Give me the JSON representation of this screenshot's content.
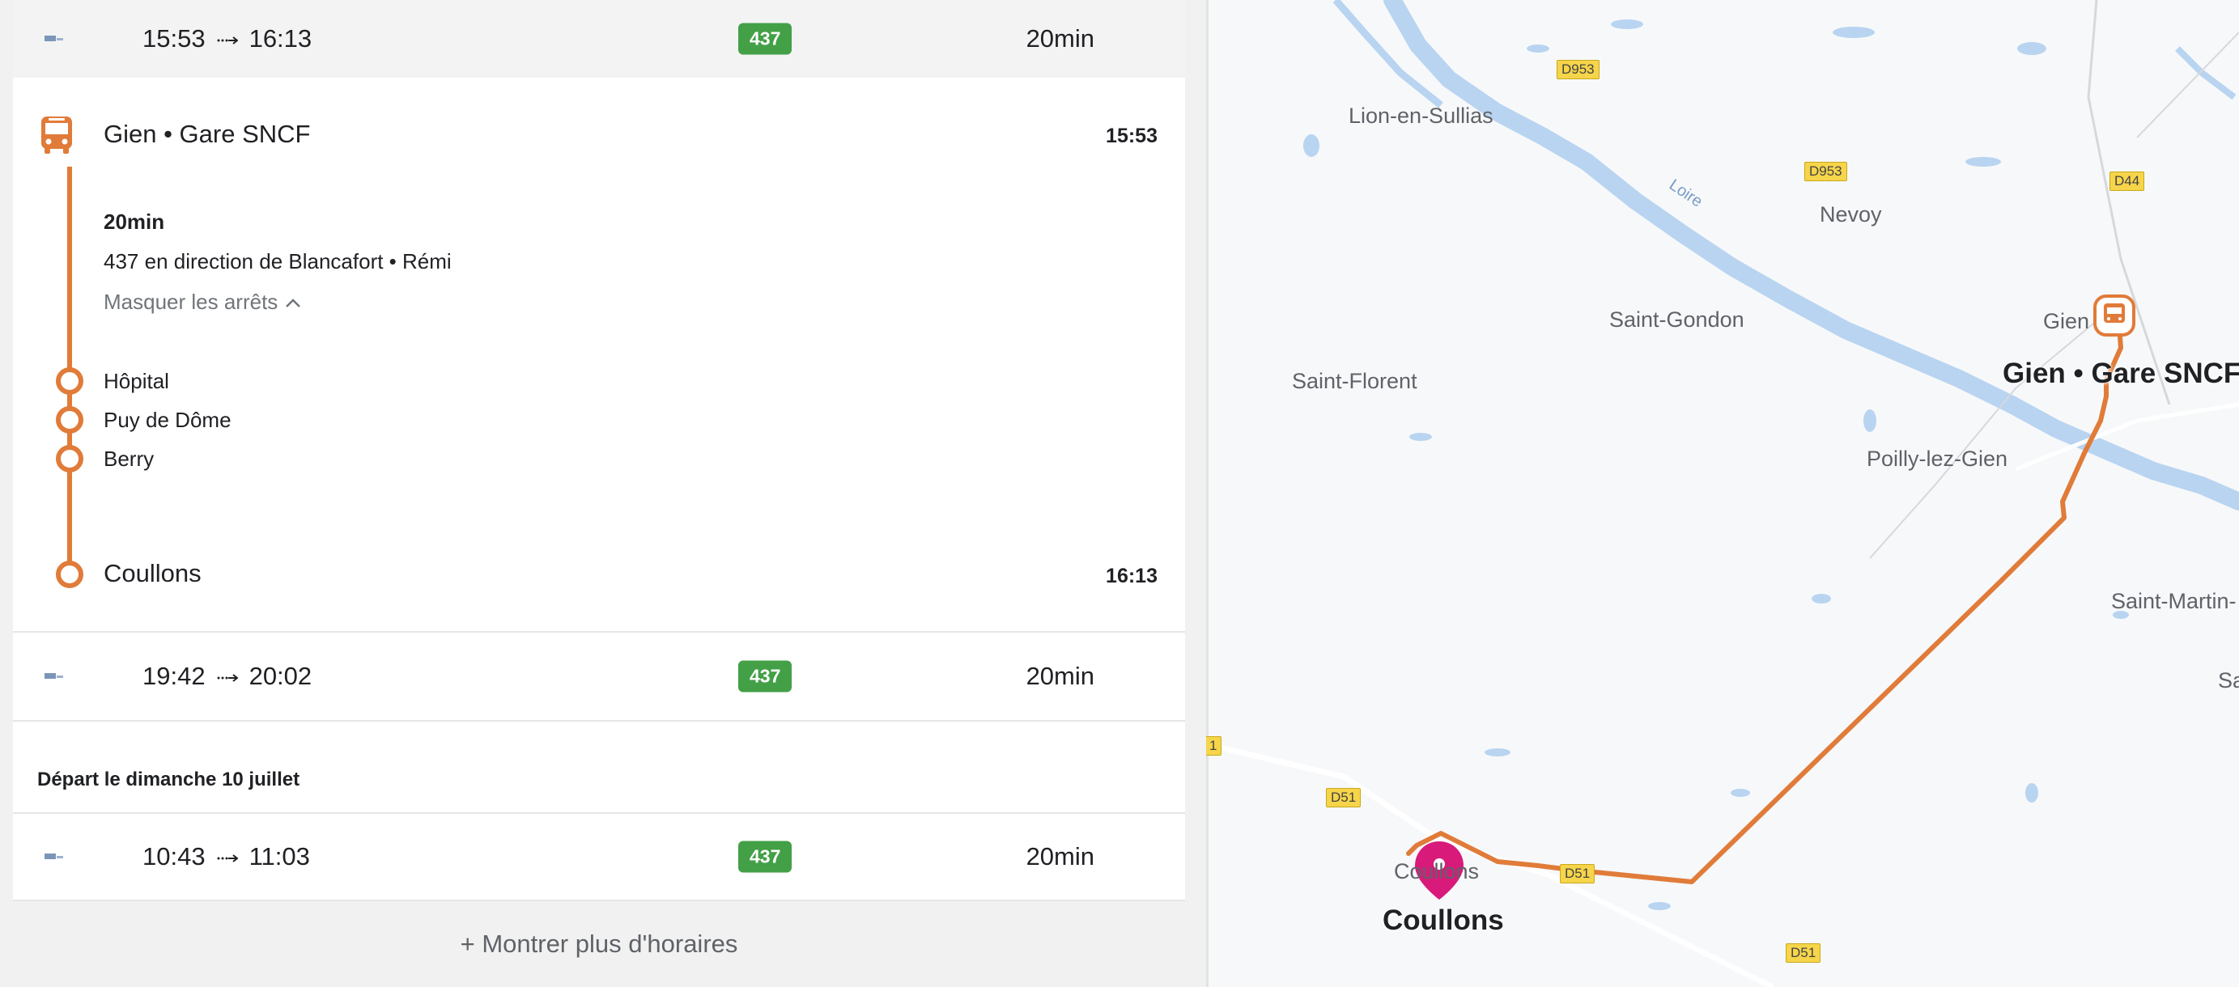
{
  "trips": [
    {
      "depart": "15:53",
      "arrive": "16:13",
      "line": "437",
      "duration": "20min"
    },
    {
      "depart": "19:42",
      "arrive": "20:02",
      "line": "437",
      "duration": "20min"
    },
    {
      "depart": "10:43",
      "arrive": "11:03",
      "line": "437",
      "duration": "20min"
    }
  ],
  "detail": {
    "origin": "Gien • Gare SNCF",
    "origin_time": "15:53",
    "duration": "20min",
    "direction": "437 en direction de Blancafort • Rémi",
    "toggle_label": "Masquer les arrêts",
    "stops": [
      "Hôpital",
      "Puy de Dôme",
      "Berry"
    ],
    "destination": "Coullons",
    "destination_time": "16:13"
  },
  "section_header": "Départ le dimanche 10 juillet",
  "more_button": "+ Montrer plus d'horaires",
  "colors": {
    "route": "#e07b39",
    "badge": "#43a047",
    "pin": "#d81b7a",
    "water": "#b8d4f0"
  },
  "map": {
    "towns": [
      "Lion-en-Sullias",
      "Nevoy",
      "Saint-Gondon",
      "Gien",
      "Saint-Florent",
      "Poilly-lez-Gien",
      "Saint-Martin-",
      "Sa",
      "Coullons"
    ],
    "river": "Loire",
    "roads": [
      "D953",
      "D953",
      "D44",
      "D51",
      "D51",
      "D51",
      "1"
    ],
    "labels": {
      "origin": "Gien • Gare SNCF",
      "destination": "Coullons"
    }
  }
}
